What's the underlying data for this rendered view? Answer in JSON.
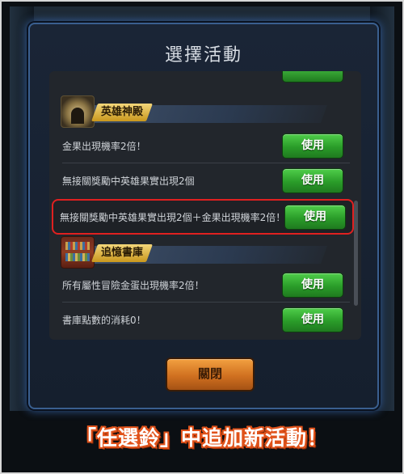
{
  "dialog": {
    "title": "選擇活動",
    "close_label": "關閉"
  },
  "sections": [
    {
      "title": "英雄神殿",
      "icon": "temple-icon",
      "rows": [
        {
          "text": "金果出現機率2倍！",
          "button": "使用",
          "highlighted": false
        },
        {
          "text": "無接關獎勵中英雄果實出現2個",
          "button": "使用",
          "highlighted": false
        },
        {
          "text": "無接關獎勵中英雄果實出現2個＋金果出現機率2倍！",
          "button": "使用",
          "highlighted": true
        }
      ]
    },
    {
      "title": "追憶書庫",
      "icon": "library-icon",
      "rows": [
        {
          "text": "所有屬性冒險金蛋出現機率2倍！",
          "button": "使用",
          "highlighted": false
        },
        {
          "text": "書庫點數的消耗0！",
          "button": "使用",
          "highlighted": false
        }
      ]
    }
  ],
  "caption": "「任選鈴」中追加新活動！",
  "colors": {
    "use_button": "#2a9c29",
    "close_button": "#d07020",
    "highlight_border": "#e02020",
    "dialog_glow": "#4682dc",
    "caption_outline": "#e0521a"
  }
}
